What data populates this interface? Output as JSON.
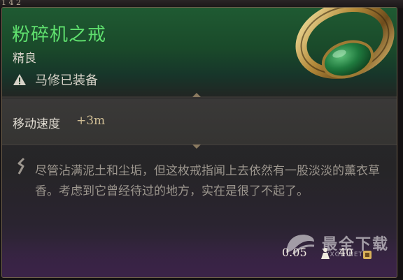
{
  "top_strip": {
    "tag": "1 4 2"
  },
  "item": {
    "name": "粉碎机之戒",
    "rarity": "精良",
    "equipped_by": "马修已装备"
  },
  "stats": {
    "label": "移动速度",
    "value": "+3m"
  },
  "description": "尽管沾满泥土和尘垢，但这枚戒指闻上去依然有一股淡淡的薰衣草香。考虑到它曾经待过的地方，实在是很了不起了。",
  "footer": {
    "weight": "0.05",
    "price": "40"
  },
  "watermark": {
    "title": "最全下载",
    "sub": "YXGU.NET"
  },
  "colors": {
    "name_green": "#5fe06e",
    "header_green": "#1f5a32",
    "value_gold": "#cfbd94",
    "bottom_purple": "#3a2347"
  },
  "icons": [
    "warning-icon",
    "ring-icon",
    "quote-icon",
    "weight-icon",
    "coin-icon"
  ]
}
